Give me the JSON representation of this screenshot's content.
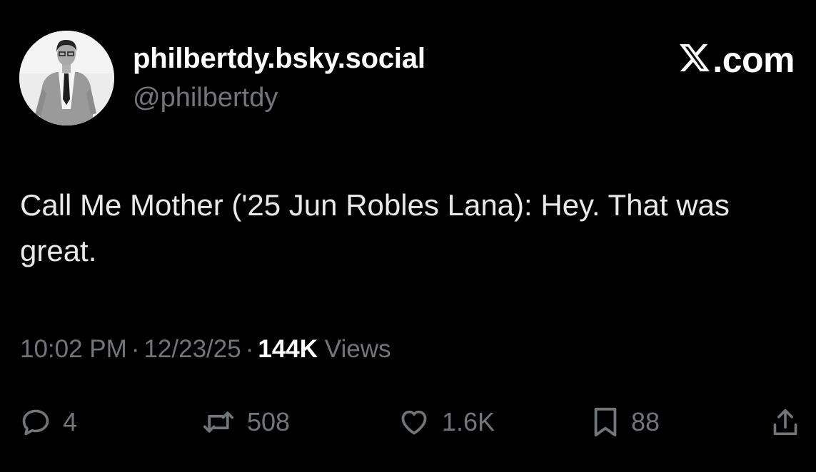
{
  "header": {
    "display_name": "philbertdy.bsky.social",
    "handle": "@philbertdy",
    "brand_text": ".com"
  },
  "tweet": {
    "text": "Call Me Mother ('25 Jun Robles Lana): Hey. That was great."
  },
  "meta": {
    "time": "10:02 PM",
    "separator": "·",
    "date": "12/23/25",
    "views_count": "144K",
    "views_label": "Views"
  },
  "actions": {
    "replies": "4",
    "reposts": "508",
    "likes": "1.6K",
    "bookmarks": "88"
  },
  "icons": {
    "brand": "x-logo-icon",
    "reply": "reply-icon",
    "repost": "repost-icon",
    "like": "heart-icon",
    "bookmark": "bookmark-icon",
    "share": "share-icon"
  },
  "colors": {
    "background": "#000000",
    "primary_text": "#e7e9ea",
    "secondary_text": "#71767b",
    "emphasis": "#ffffff"
  }
}
